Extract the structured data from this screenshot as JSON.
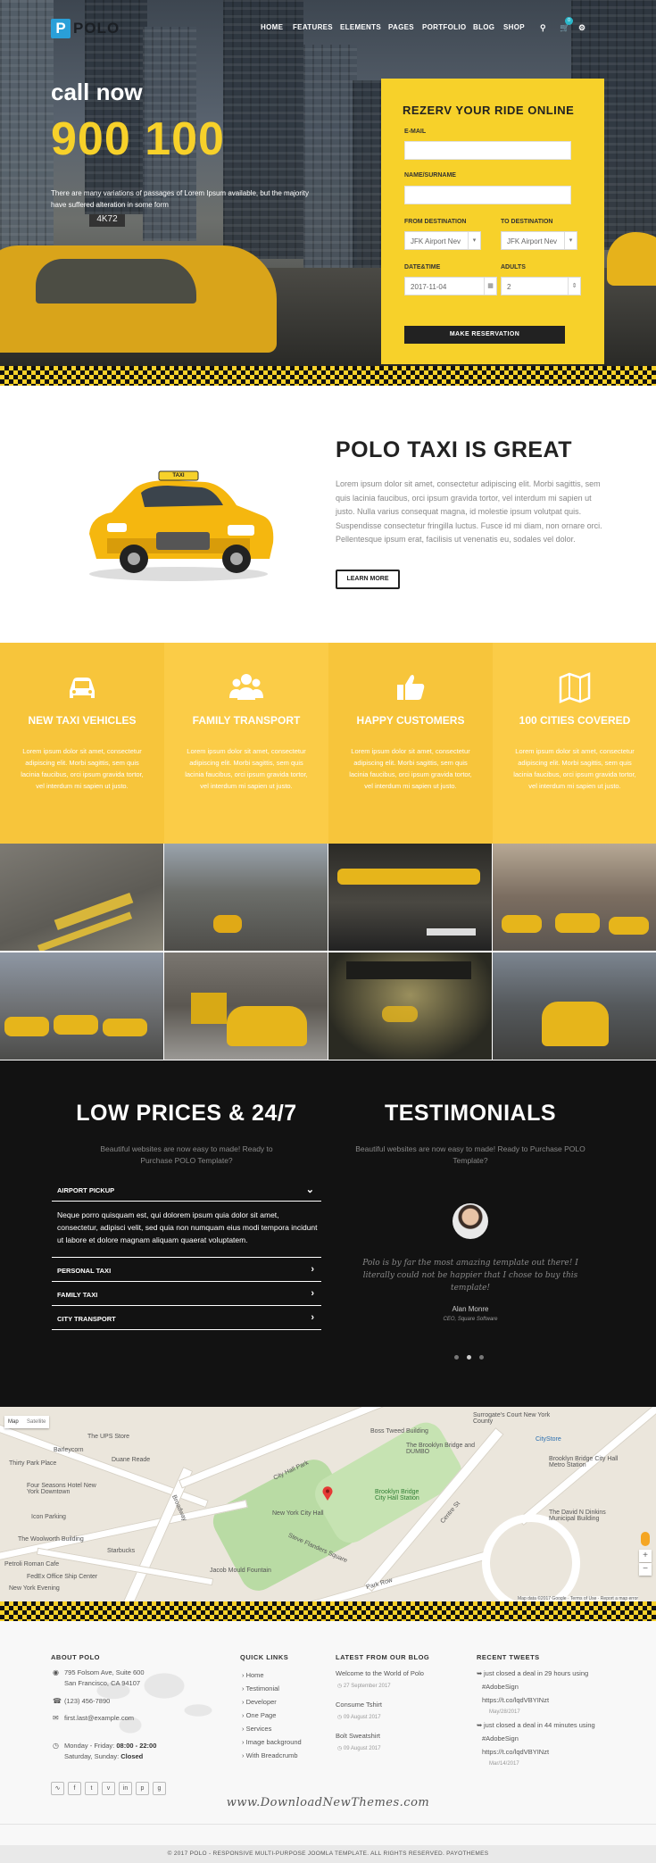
{
  "brand": {
    "logo_letter": "P",
    "logo_text": "POLO",
    "accent": "#f7d12a",
    "dark": "#121212"
  },
  "nav": {
    "items": [
      "HOME",
      "FEATURES",
      "ELEMENTS",
      "PAGES",
      "PORTFOLIO",
      "BLOG",
      "SHOP"
    ],
    "cart_count": "0"
  },
  "hero": {
    "call_text": "call now",
    "phone": "900 100",
    "description": "There are many variations of passages of Lorem Ipsum available, but the majority have suffered alteration in some form"
  },
  "reservation": {
    "title": "REZERV YOUR RIDE ONLINE",
    "email_label": "E-MAIL",
    "name_label": "NAME/SURNAME",
    "from_label": "FROM DESTINATION",
    "to_label": "TO DESTINATION",
    "from_value": "JFK Airport Nev",
    "to_value": "JFK Airport Nev",
    "date_label": "DATE&TIME",
    "date_value": "2017-11-04",
    "adults_label": "ADULTS",
    "adults_value": "2",
    "submit_label": "MAKE RESERVATION"
  },
  "about": {
    "title": "POLO TAXI IS GREAT",
    "text": "Lorem ipsum dolor sit amet, consectetur adipiscing elit. Morbi sagittis, sem quis lacinia faucibus, orci ipsum gravida tortor, vel interdum mi sapien ut justo. Nulla varius consequat magna, id molestie ipsum volutpat quis. Suspendisse consectetur fringilla luctus. Fusce id mi diam, non ornare orci. Pellentesque ipsum erat, facilisis ut venenatis eu, sodales vel dolor.",
    "button": "LEARN MORE",
    "taxi_sign": "TAXI"
  },
  "features": [
    {
      "title": "NEW TAXI VEHICLES",
      "text": "Lorem ipsum dolor sit amet, consectetur adipiscing elit. Morbi sagittis, sem quis lacinia faucibus, orci ipsum gravida tortor, vel interdum mi sapien ut justo.",
      "icon": "car-icon",
      "color": "#f7c53b"
    },
    {
      "title": "FAMILY TRANSPORT",
      "text": "Lorem ipsum dolor sit amet, consectetur adipiscing elit. Morbi sagittis, sem quis lacinia faucibus, orci ipsum gravida tortor, vel interdum mi sapien ut justo.",
      "icon": "users-icon",
      "color": "#fbcc47"
    },
    {
      "title": "HAPPY CUSTOMERS",
      "text": "Lorem ipsum dolor sit amet, consectetur adipiscing elit. Morbi sagittis, sem quis lacinia faucibus, orci ipsum gravida tortor, vel interdum mi sapien ut justo.",
      "icon": "thumbs-up-icon",
      "color": "#f7c53b"
    },
    {
      "title": "100 CITIES COVERED",
      "text": "Lorem ipsum dolor sit amet, consectetur adipiscing elit. Morbi sagittis, sem quis lacinia faucibus, orci ipsum gravida tortor, vel interdum mi sapien ut justo.",
      "icon": "map-icon",
      "color": "#fbcc47"
    }
  ],
  "prices": {
    "title": "LOW PRICES & 24/7",
    "subtitle": "Beautiful websites are now easy to made! Ready to Purchase POLO Template?",
    "accordion": [
      {
        "label": "AIRPORT PICKUP",
        "open": true,
        "body": "Neque porro quisquam est, qui dolorem ipsum quia dolor sit amet, consectetur, adipisci velit, sed quia non numquam eius modi tempora incidunt ut labore et dolore magnam aliquam quaerat voluptatem."
      },
      {
        "label": "PERSONAL TAXI",
        "open": false
      },
      {
        "label": "FAMILY TAXI",
        "open": false
      },
      {
        "label": "CITY TRANSPORT",
        "open": false
      }
    ]
  },
  "testimonials": {
    "title": "TESTIMONIALS",
    "subtitle": "Beautiful websites are now easy to made! Ready to Purchase POLO Template?",
    "quote": "Polo is by far the most amazing template out there! I literally could not be happier that I chose to buy this template!",
    "author": "Alan Monre",
    "role": "CEO, Square Software"
  },
  "map": {
    "tabs": [
      "Map",
      "Satellite"
    ],
    "labels": [
      "The UPS Store",
      "Barleycorn",
      "Thirty Park Place",
      "Duane Reade",
      "Four Seasons Hotel New York Downtown",
      "Icon Parking",
      "The Woolworth Building",
      "Starbucks",
      "Petroli Roman Cafe",
      "FedEx Office Ship Center",
      "New York Evening",
      "City Hall Park",
      "New York City Hall",
      "Boss Tweed Building",
      "The Brooklyn Bridge and DUMBO",
      "Brooklyn Bridge City Hall Station",
      "Jacob Mould Fountain",
      "Surrogate's Court New York County",
      "CityStore",
      "Brooklyn Bridge City Hall Metro Station",
      "The David N Dinkins Municipal Building",
      "Park Row",
      "Broadway",
      "Centre St",
      "Steve Flanders Square"
    ],
    "attribution": "Map data ©2017 Google · Terms of Use · Report a map error"
  },
  "footer": {
    "about": {
      "title": "ABOUT POLO",
      "address1": "795 Folsom Ave, Suite 600",
      "address2": "San Francisco, CA 94107",
      "phone": "(123) 456-7890",
      "email": "first.last@example.com",
      "hours1_prefix": "Monday - Friday: ",
      "hours1_value": "08:00 - 22:00",
      "hours2_prefix": "Saturday, Sunday: ",
      "hours2_value": "Closed"
    },
    "quick_links": {
      "title": "QUICK LINKS",
      "items": [
        "Home",
        "Testimonial",
        "Developer",
        "One Page",
        "Services",
        "Image background",
        "With Breadcrumb"
      ]
    },
    "blog": {
      "title": "LATEST FROM OUR BLOG",
      "items": [
        {
          "title": "Welcome to the World of Polo",
          "date": "27 September 2017"
        },
        {
          "title": "Consume Tshirt",
          "date": "09 August 2017"
        },
        {
          "title": "Bolt Sweatshirt",
          "date": "09 August 2017"
        }
      ]
    },
    "tweets": {
      "title": "RECENT TWEETS",
      "items": [
        {
          "line1": "just closed a deal in 29 hours using",
          "tag": "#AdobeSign",
          "link": "https://t.co/lqdVBYINzt",
          "date": "May/28/2017"
        },
        {
          "line1": "just closed a deal in 44 minutes using",
          "tag": "#AdobeSign",
          "link": "https://t.co/lqdVBYINzt",
          "date": "Mar/14/2017"
        }
      ]
    },
    "social": [
      "rss-icon",
      "facebook-icon",
      "twitter-icon",
      "vimeo-icon",
      "linkedin-icon",
      "pinterest-icon",
      "google-plus-icon"
    ],
    "watermark": "www.DownloadNewThemes.com",
    "copyright": "© 2017 POLO - RESPONSIVE MULTI-PURPOSE JOOMLA TEMPLATE. ALL RIGHTS RESERVED. PAYOTHEMES"
  }
}
